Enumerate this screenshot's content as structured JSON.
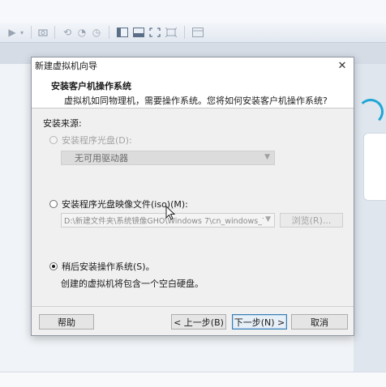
{
  "dialog": {
    "title": "新建虚拟机向导",
    "close_glyph": "✕",
    "header_title": "安装客户机操作系统",
    "header_subtitle": "虚拟机如同物理机，需要操作系统。您将如何安装客户机操作系统?",
    "source_label": "安装来源:",
    "options": {
      "disc": {
        "label": "安装程序光盘(D):",
        "selected": false,
        "enabled": false
      },
      "disc_drive_value": "无可用驱动器",
      "iso": {
        "label": "安装程序光盘映像文件(iso)(M):",
        "selected": false,
        "enabled": true
      },
      "iso_path_value": "D:\\新建文件夹\\系统镜像GHO\\Windows 7\\cn_windows_7",
      "browse_label": "浏览(R)...",
      "later": {
        "label": "稍后安装操作系统(S)。",
        "selected": true,
        "enabled": true
      },
      "later_description": "创建的虚拟机将包含一个空白硬盘。"
    },
    "buttons": {
      "help": "帮助",
      "back": "< 上一步(B)",
      "next": "下一步(N) >",
      "cancel": "取消"
    }
  },
  "toolbar": {
    "icons": [
      "play-icon",
      "dropdown-icon",
      "snapshot-icon",
      "revert-icon",
      "snapshot-manager-icon",
      "clock-icon",
      "sidebar-view-icon",
      "console-view-icon",
      "fullscreen-icon",
      "unity-icon",
      "tab-view-icon"
    ]
  },
  "colors": {
    "accent": "#20a6d6",
    "primary_button_border": "#3c7fb1"
  }
}
